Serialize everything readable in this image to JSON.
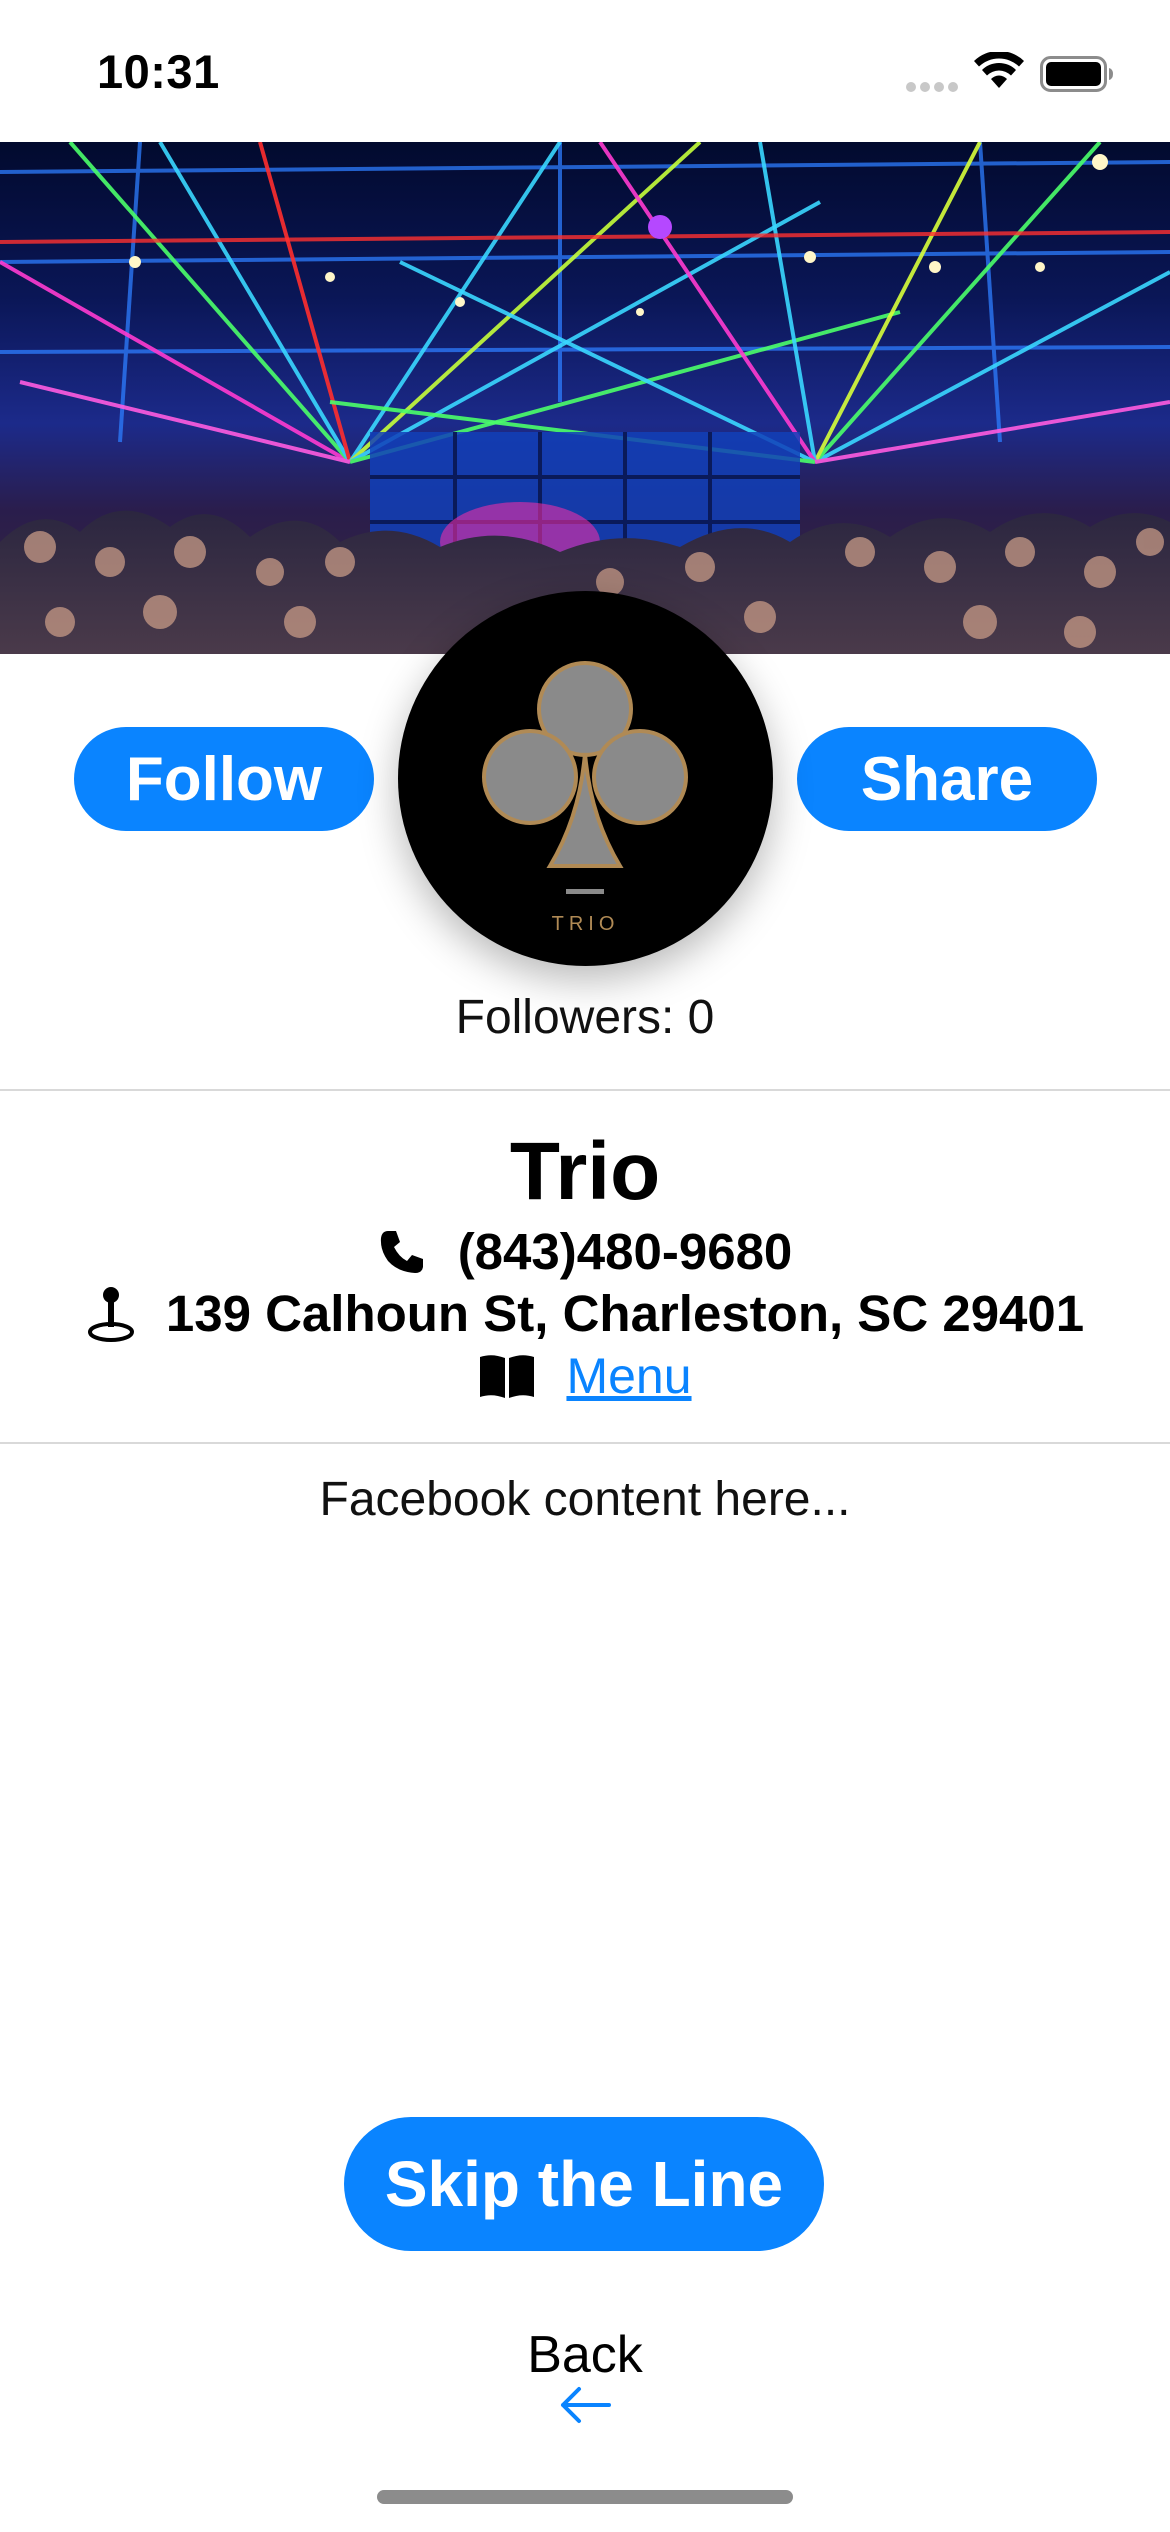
{
  "status_bar": {
    "time": "10:31"
  },
  "venue": {
    "name": "Trio",
    "logo_text": "TRIO",
    "phone": "(843)480-9680",
    "address": "139 Calhoun St, Charleston, SC 29401",
    "menu_label": "Menu",
    "followers_label": "Followers: 0"
  },
  "actions": {
    "follow_label": "Follow",
    "share_label": "Share",
    "skip_label": "Skip the Line",
    "back_label": "Back"
  },
  "feed": {
    "placeholder": "Facebook content here..."
  },
  "colors": {
    "accent": "#0a84ff",
    "logo_gold": "#b08a55",
    "logo_gray": "#8a8a8a"
  },
  "icons": [
    "wifi-icon",
    "battery-icon",
    "phone-icon",
    "joystick-location-icon",
    "book-icon",
    "back-arrow-icon"
  ]
}
